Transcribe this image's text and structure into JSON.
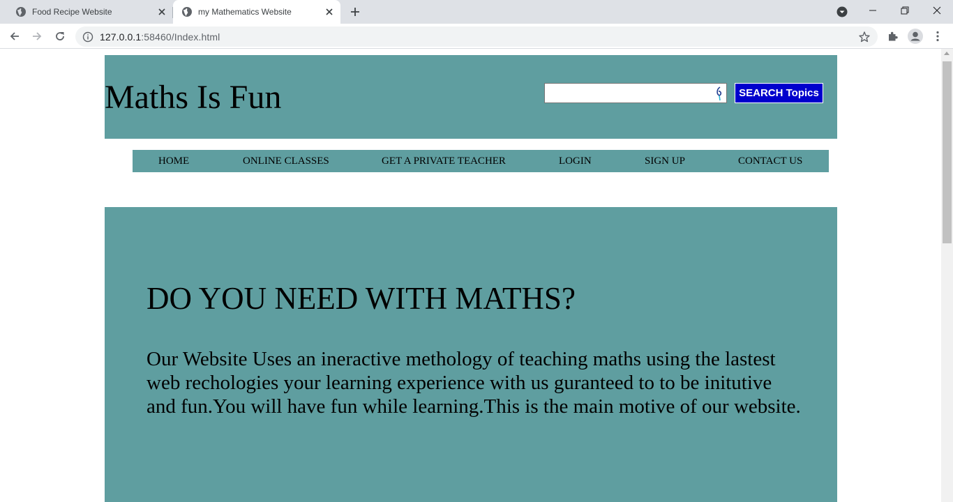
{
  "browser": {
    "tabs": [
      {
        "title": "Food Recipe Website",
        "active": false
      },
      {
        "title": "my Mathematics Website",
        "active": true
      }
    ],
    "url": {
      "host": "127.0.0.1",
      "port_path": ":58460/Index.html"
    }
  },
  "header": {
    "title": "Maths Is Fun",
    "search": {
      "value": "",
      "placeholder": ""
    },
    "search_button": "SEARCH Topics"
  },
  "menu": {
    "items": [
      {
        "label": "HOME"
      },
      {
        "label": "ONLINE CLASSES"
      },
      {
        "label": "GET A PRIVATE TEACHER"
      },
      {
        "label": "LOGIN"
      },
      {
        "label": "SIGN UP"
      },
      {
        "label": "CONTACT US"
      }
    ]
  },
  "hero": {
    "heading": "DO YOU NEED WITH MATHS?",
    "body": "Our Website Uses an ineractive methology of teaching maths using the lastest web rechologies your learning experience with us guranteed to to be initutive and fun.You will have fun while learning.This is the main motive of our website."
  },
  "colors": {
    "section_bg": "#5f9ea0",
    "search_button_bg": "#0000cd",
    "tabstrip_bg": "#dee1e6"
  }
}
